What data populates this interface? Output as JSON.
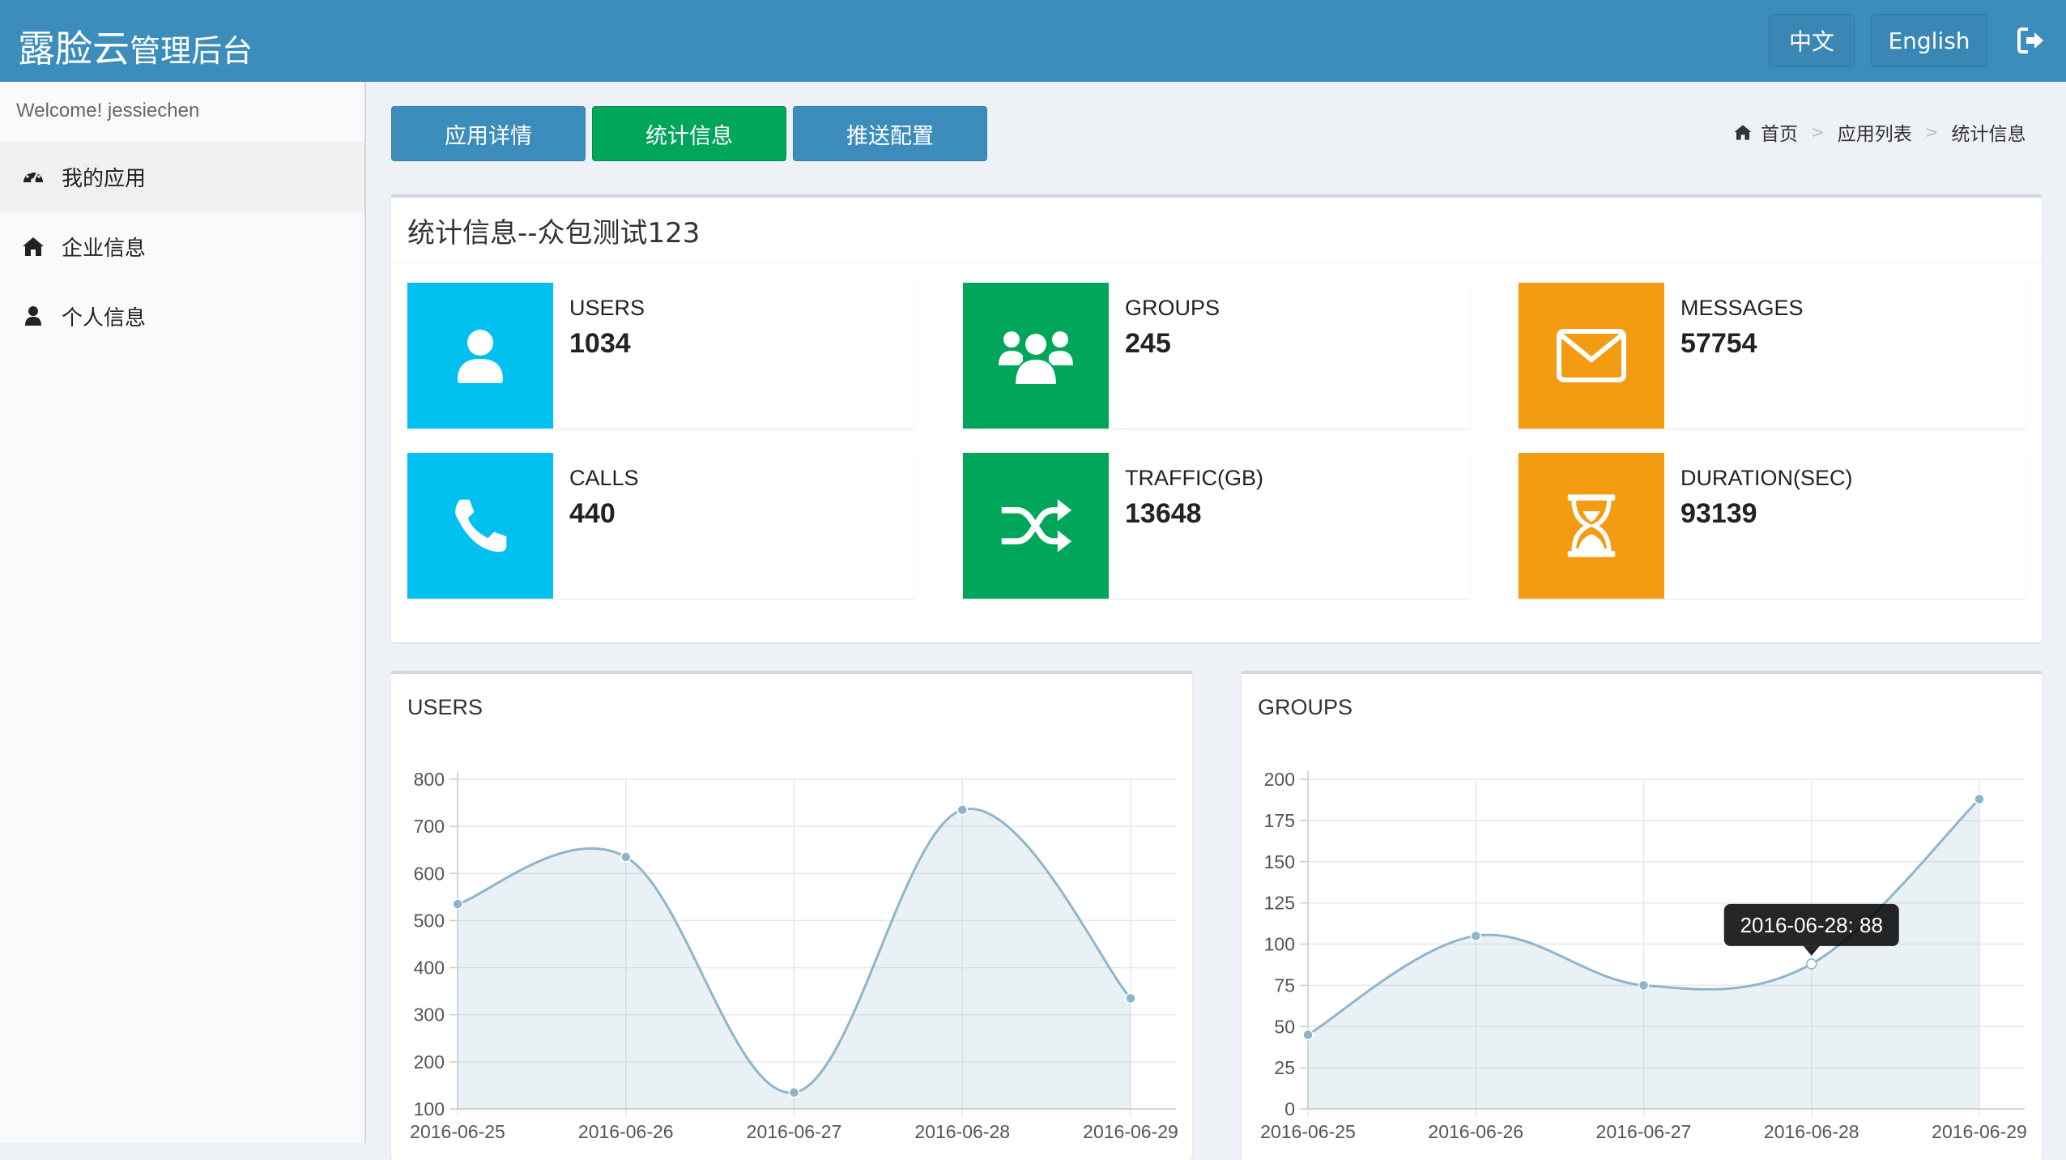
{
  "header": {
    "brand_main": "露脸云",
    "brand_sub": "管理后台",
    "lang_zh": "中文",
    "lang_en": "English",
    "logout_icon": "sign-out-icon",
    "bg_color": "#3c8dbc"
  },
  "sidebar": {
    "welcome": "Welcome! jessiechen",
    "items": [
      {
        "label": "我的应用",
        "icon": "dashboard-icon",
        "active": true
      },
      {
        "label": "企业信息",
        "icon": "home-icon",
        "active": false
      },
      {
        "label": "个人信息",
        "icon": "user-icon",
        "active": false
      }
    ]
  },
  "tabs": [
    {
      "label": "应用详情",
      "style": "blue"
    },
    {
      "label": "统计信息",
      "style": "green"
    },
    {
      "label": "推送配置",
      "style": "blue"
    }
  ],
  "breadcrumb": {
    "home": "首页",
    "list": "应用列表",
    "current": "统计信息",
    "home_icon": "home-icon"
  },
  "stats_panel": {
    "title": "统计信息--众包测试123",
    "boxes": [
      {
        "label": "USERS",
        "value": "1034",
        "icon": "user-icon",
        "color": "#00c0ef"
      },
      {
        "label": "GROUPS",
        "value": "245",
        "icon": "users-icon",
        "color": "#00a65a"
      },
      {
        "label": "MESSAGES",
        "value": "57754",
        "icon": "envelope-icon",
        "color": "#f39c12"
      },
      {
        "label": "CALLS",
        "value": "440",
        "icon": "phone-icon",
        "color": "#00c0ef"
      },
      {
        "label": "TRAFFIC(GB)",
        "value": "13648",
        "icon": "random-icon",
        "color": "#00a65a"
      },
      {
        "label": "DURATION(SEC)",
        "value": "93139",
        "icon": "hourglass-icon",
        "color": "#f39c12"
      }
    ]
  },
  "chart_data": [
    {
      "type": "line",
      "title": "USERS",
      "x": [
        "2016-06-25",
        "2016-06-26",
        "2016-06-27",
        "2016-06-28",
        "2016-06-29"
      ],
      "values": [
        535,
        635,
        135,
        735,
        335
      ],
      "yticks": [
        100,
        200,
        300,
        400,
        500,
        600,
        700,
        800
      ],
      "ylim": [
        100,
        800
      ],
      "grid": true,
      "fill": true,
      "color": "#8fb5cc"
    },
    {
      "type": "line",
      "title": "GROUPS",
      "x": [
        "2016-06-25",
        "2016-06-26",
        "2016-06-27",
        "2016-06-28",
        "2016-06-29"
      ],
      "values": [
        45,
        105,
        75,
        88,
        188
      ],
      "yticks": [
        0,
        25,
        50,
        75,
        100,
        125,
        150,
        175,
        200
      ],
      "ylim": [
        0,
        200
      ],
      "grid": true,
      "fill": true,
      "color": "#8fb5cc",
      "tooltip": {
        "index": 3,
        "text": "2016-06-28: 88"
      }
    }
  ]
}
